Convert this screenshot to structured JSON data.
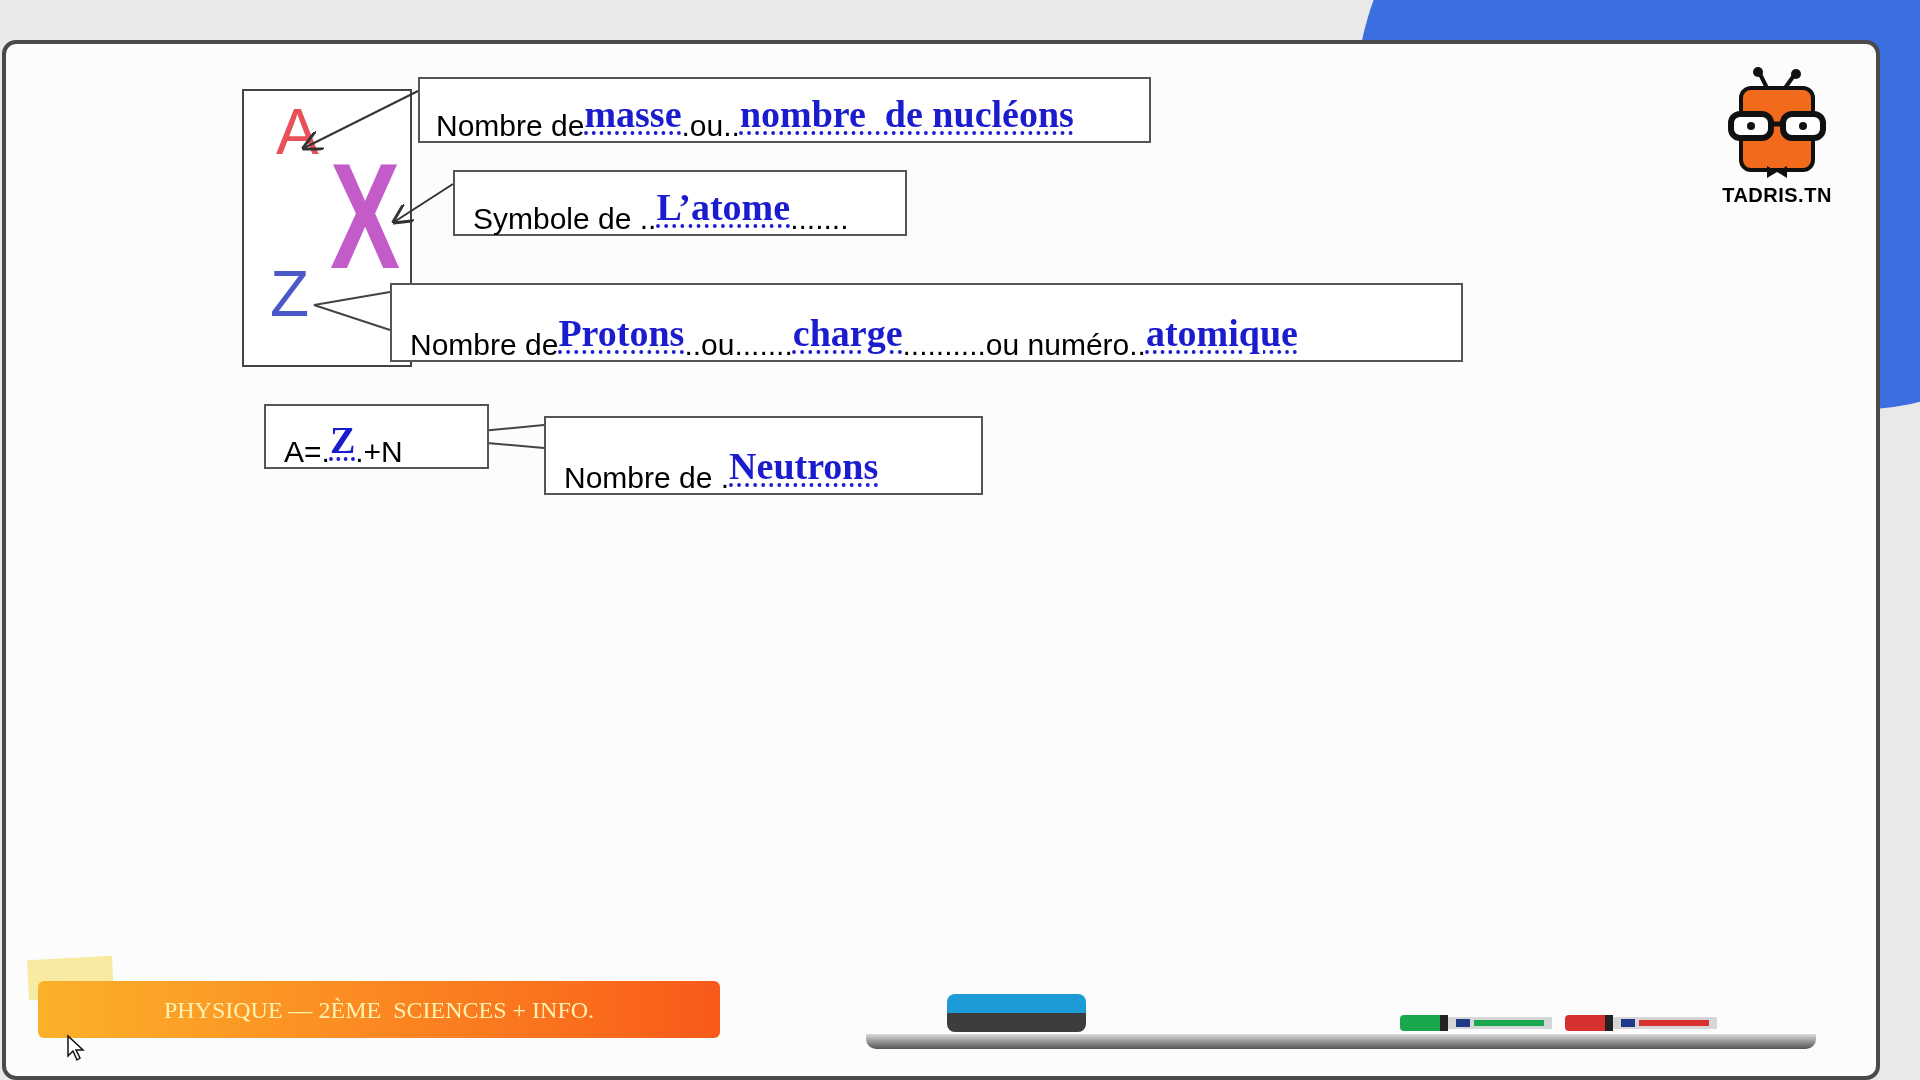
{
  "symbol": {
    "mass_number": "A",
    "element": "X",
    "atomic_number": "Z"
  },
  "callouts": [
    {
      "segments": [
        {
          "kind": "text",
          "text": "Nombre de"
        },
        {
          "kind": "answer",
          "text": "masse"
        },
        {
          "kind": "text",
          "text": ".ou.."
        },
        {
          "kind": "answer",
          "text": "nombre  de nucléons"
        }
      ]
    },
    {
      "segments": [
        {
          "kind": "text",
          "text": "Symbole de .."
        },
        {
          "kind": "answer",
          "text": "L’atome"
        },
        {
          "kind": "text",
          "text": "......."
        }
      ]
    },
    {
      "segments": [
        {
          "kind": "text",
          "text": "Nombre de"
        },
        {
          "kind": "answer",
          "text": "Protons"
        },
        {
          "kind": "text",
          "text": "..ou......."
        },
        {
          "kind": "answer",
          "text": "charge"
        },
        {
          "kind": "text",
          "text": "..........ou numéro.."
        },
        {
          "kind": "answer",
          "text": "atomique"
        }
      ]
    },
    {
      "segments": [
        {
          "kind": "text",
          "text": "A=."
        },
        {
          "kind": "answer",
          "text": "Z"
        },
        {
          "kind": "text",
          "text": ".+N"
        }
      ]
    },
    {
      "segments": [
        {
          "kind": "text",
          "text": "Nombre de ."
        },
        {
          "kind": "answer",
          "text": "Neutrons"
        }
      ]
    }
  ],
  "logo": {
    "text": "TADRIS.TN"
  },
  "banner": {
    "text": "PHYSIQUE — 2ÈME  SCIENCES + INFO."
  }
}
